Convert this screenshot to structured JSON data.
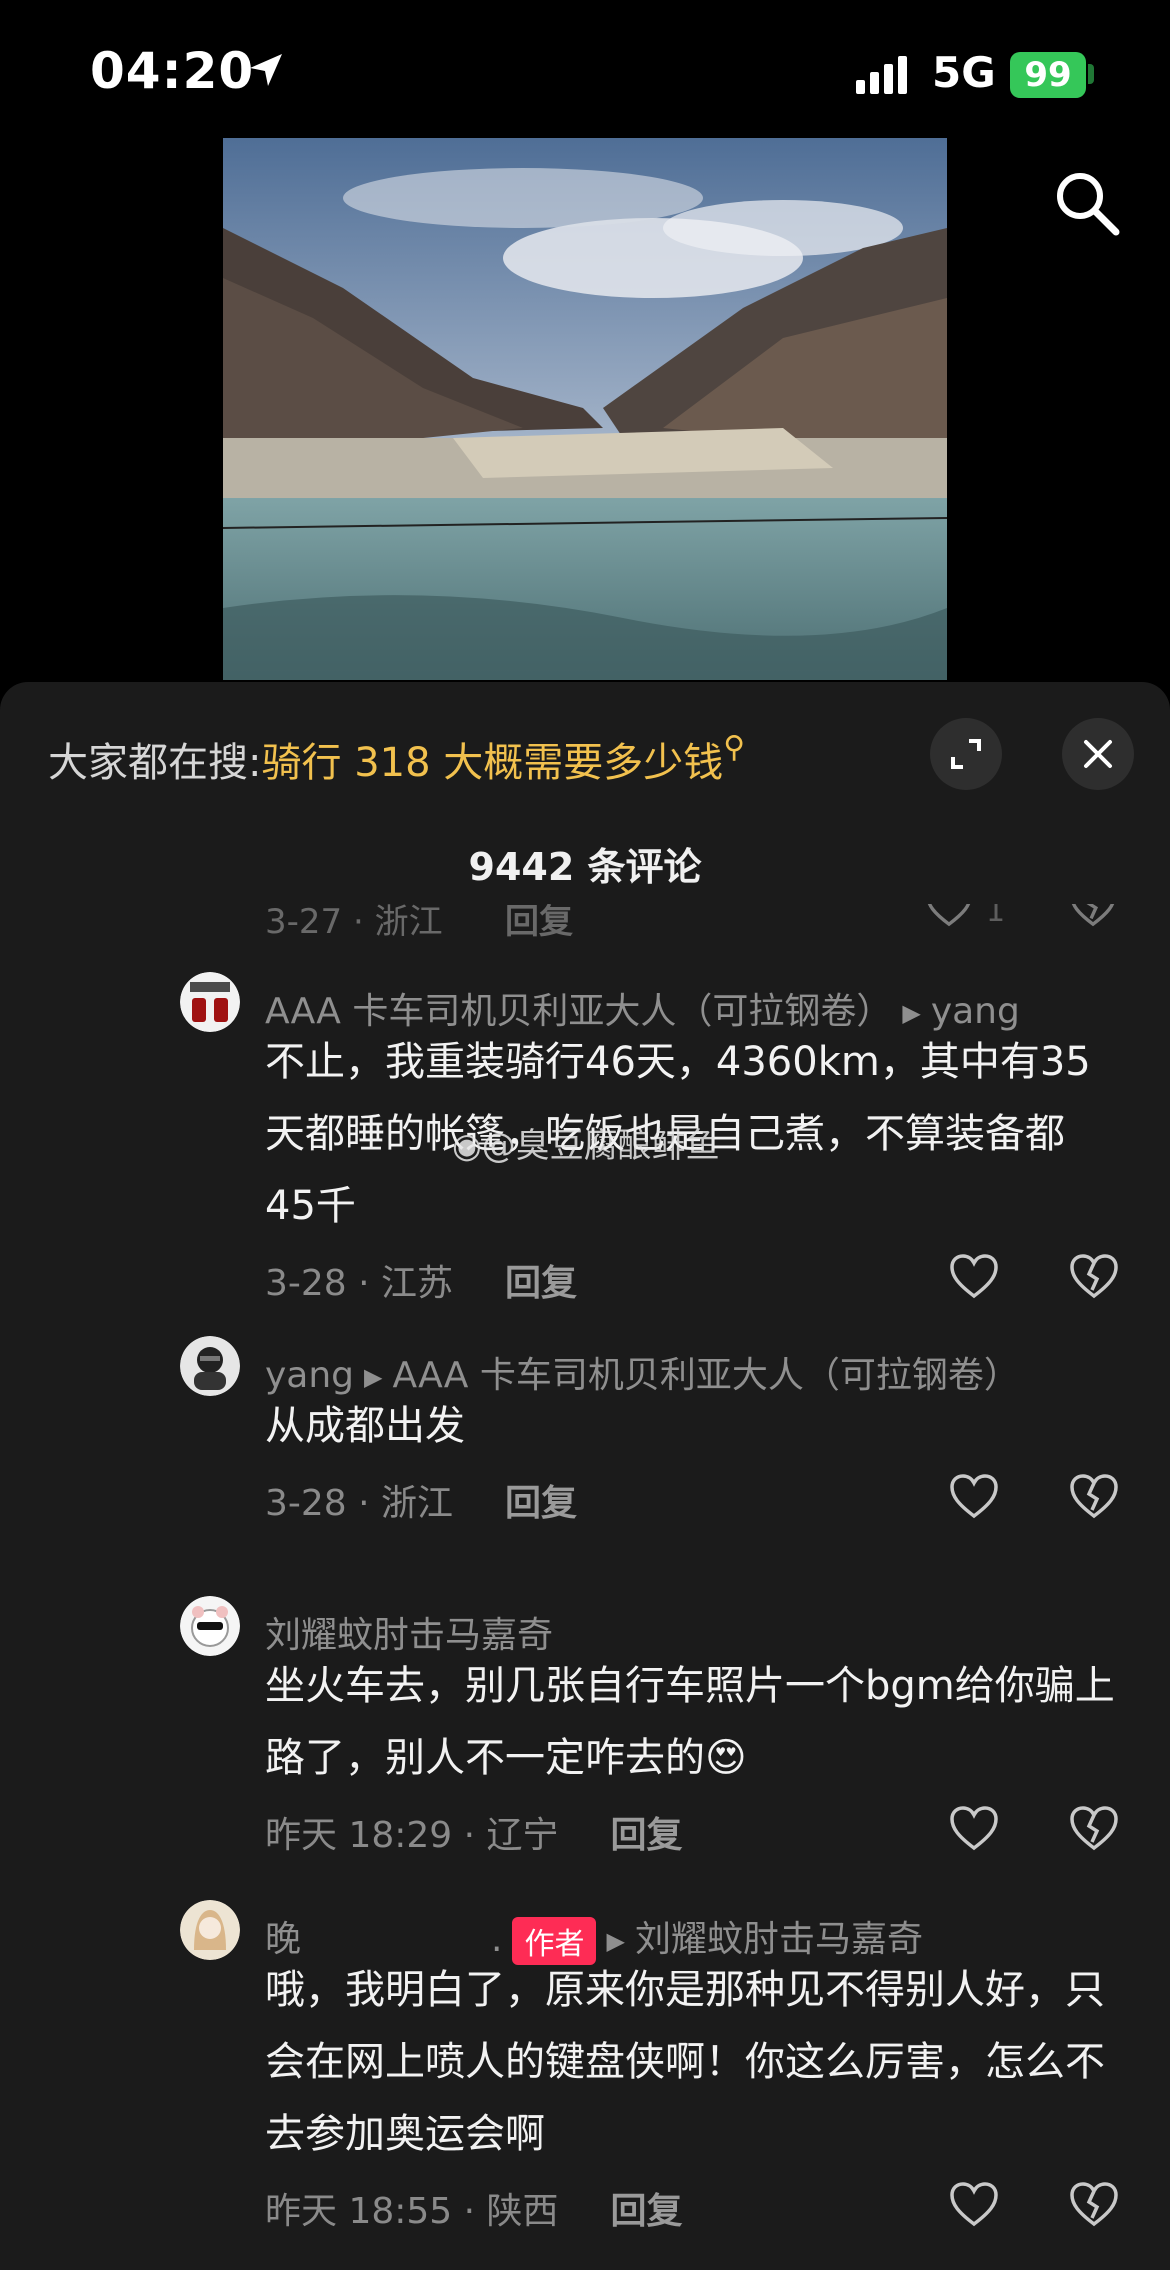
{
  "status_bar": {
    "time": "04:20",
    "network": "5G",
    "battery": "99"
  },
  "sheet": {
    "hot_search_prefix": "大家都在搜:",
    "hot_search_keyword": "骑行 318 大概需要多少钱",
    "comment_count": "9442 条评论"
  },
  "partial_comment": {
    "meta": "3-27 · 浙江",
    "reply": "回复",
    "likes": "1"
  },
  "comments": [
    {
      "user": "AAA 卡车司机贝利亚大人（可拉钢卷）",
      "reply_to": "yang",
      "text": "不止，我重装骑行46天，4360km，其中有35天都睡的帐篷，吃饭也是自己煮，不算装备都45千",
      "meta": "3-28 · 江苏",
      "reply": "回复"
    },
    {
      "user": "yang",
      "reply_to": "AAA 卡车司机贝利亚大人（可拉钢卷）",
      "text": "从成都出发",
      "meta": "3-28 · 浙江",
      "reply": "回复"
    },
    {
      "user": "刘耀蚊肘击马嘉奇",
      "reply_to": "",
      "text": "坐火车去，别几张自行车照片一个bgm给你骗上路了，别人不一定咋去的😍",
      "meta": "昨天 18:29 · 辽宁",
      "reply": "回复"
    },
    {
      "user": "晚",
      "user_suffix": ".",
      "badge": "作者",
      "reply_to": "刘耀蚊肘击马嘉奇",
      "text": "哦，我明白了，原来你是那种见不得别人好，只会在网上喷人的键盘侠啊！你这么厉害，怎么不去参加奥运会啊",
      "meta": "昨天 18:55 · 陕西",
      "reply": "回复"
    }
  ],
  "watermark": "@臭豆腐酿鲱鱼",
  "colors": {
    "accent_keyword": "#f2c14e",
    "author_badge": "#fe2c55",
    "battery": "#35c759",
    "sheet_bg": "#1b1b1b"
  },
  "icons": [
    "location-arrow-icon",
    "signal-icon",
    "search-icon",
    "expand-icon",
    "close-icon",
    "heart-icon",
    "broken-heart-icon"
  ]
}
